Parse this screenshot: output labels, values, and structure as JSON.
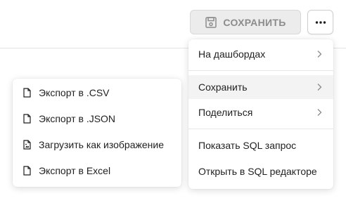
{
  "toolbar": {
    "save_label": "СОХРАНИТЬ",
    "save_icon": "save-icon",
    "more_icon": "more-dots-icon"
  },
  "main_menu": {
    "items": [
      {
        "label": "На дашбордах",
        "has_submenu": true
      },
      {
        "label": "Сохранить",
        "has_submenu": true,
        "active": true
      },
      {
        "label": "Поделиться",
        "has_submenu": true
      },
      {
        "label": "Показать SQL запрос",
        "has_submenu": false
      },
      {
        "label": "Открыть в SQL редакторе",
        "has_submenu": false
      }
    ]
  },
  "save_submenu": {
    "items": [
      {
        "label": "Экспорт в .CSV",
        "icon": "file-icon"
      },
      {
        "label": "Экспорт в .JSON",
        "icon": "file-icon"
      },
      {
        "label": "Загрузить как изображение",
        "icon": "image-file-icon"
      },
      {
        "label": "Экспорт в Excel",
        "icon": "file-icon"
      }
    ]
  },
  "colors": {
    "save_button_bg": "#ececec",
    "save_button_text": "#8c8c8c",
    "active_item_bg": "#f3f3f3"
  }
}
